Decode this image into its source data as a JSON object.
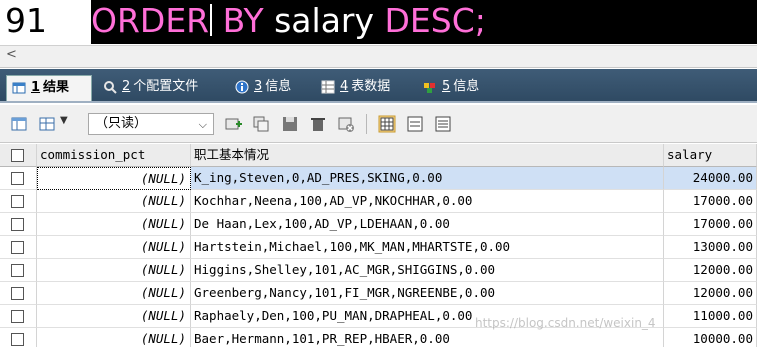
{
  "editor": {
    "line_number": "91",
    "kw1": "ORDER",
    "kw2": "BY",
    "ident": "salary",
    "kw3": "DESC",
    "semicolon": ";"
  },
  "scroll": {
    "left_arrow": "<"
  },
  "tabs": [
    {
      "num": "1",
      "label": "结果",
      "active": true
    },
    {
      "num": "2",
      "label": "个配置文件"
    },
    {
      "num": "3",
      "label": "信息"
    },
    {
      "num": "4",
      "label": "表数据"
    },
    {
      "num": "5",
      "label": "信息"
    }
  ],
  "toolbar": {
    "mode_select": "（只读）"
  },
  "grid": {
    "columns": [
      "commission_pct",
      "职工基本情况",
      "salary"
    ],
    "rows": [
      [
        "(NULL)",
        "K_ing,Steven,0,AD_PRES,SKING,0.00",
        "24000.00"
      ],
      [
        "(NULL)",
        "Kochhar,Neena,100,AD_VP,NKOCHHAR,0.00",
        "17000.00"
      ],
      [
        "(NULL)",
        "De Haan,Lex,100,AD_VP,LDEHAAN,0.00",
        "17000.00"
      ],
      [
        "(NULL)",
        "Hartstein,Michael,100,MK_MAN,MHARTSTE,0.00",
        "13000.00"
      ],
      [
        "(NULL)",
        "Higgins,Shelley,101,AC_MGR,SHIGGINS,0.00",
        "12000.00"
      ],
      [
        "(NULL)",
        "Greenberg,Nancy,101,FI_MGR,NGREENBE,0.00",
        "12000.00"
      ],
      [
        "(NULL)",
        "Raphaely,Den,100,PU_MAN,DRAPHEAL,0.00",
        "11000.00"
      ],
      [
        "(NULL)",
        "Baer,Hermann,101,PR_REP,HBAER,0.00",
        "10000.00"
      ]
    ]
  },
  "watermark": "https://blog.csdn.net/weixin_4"
}
